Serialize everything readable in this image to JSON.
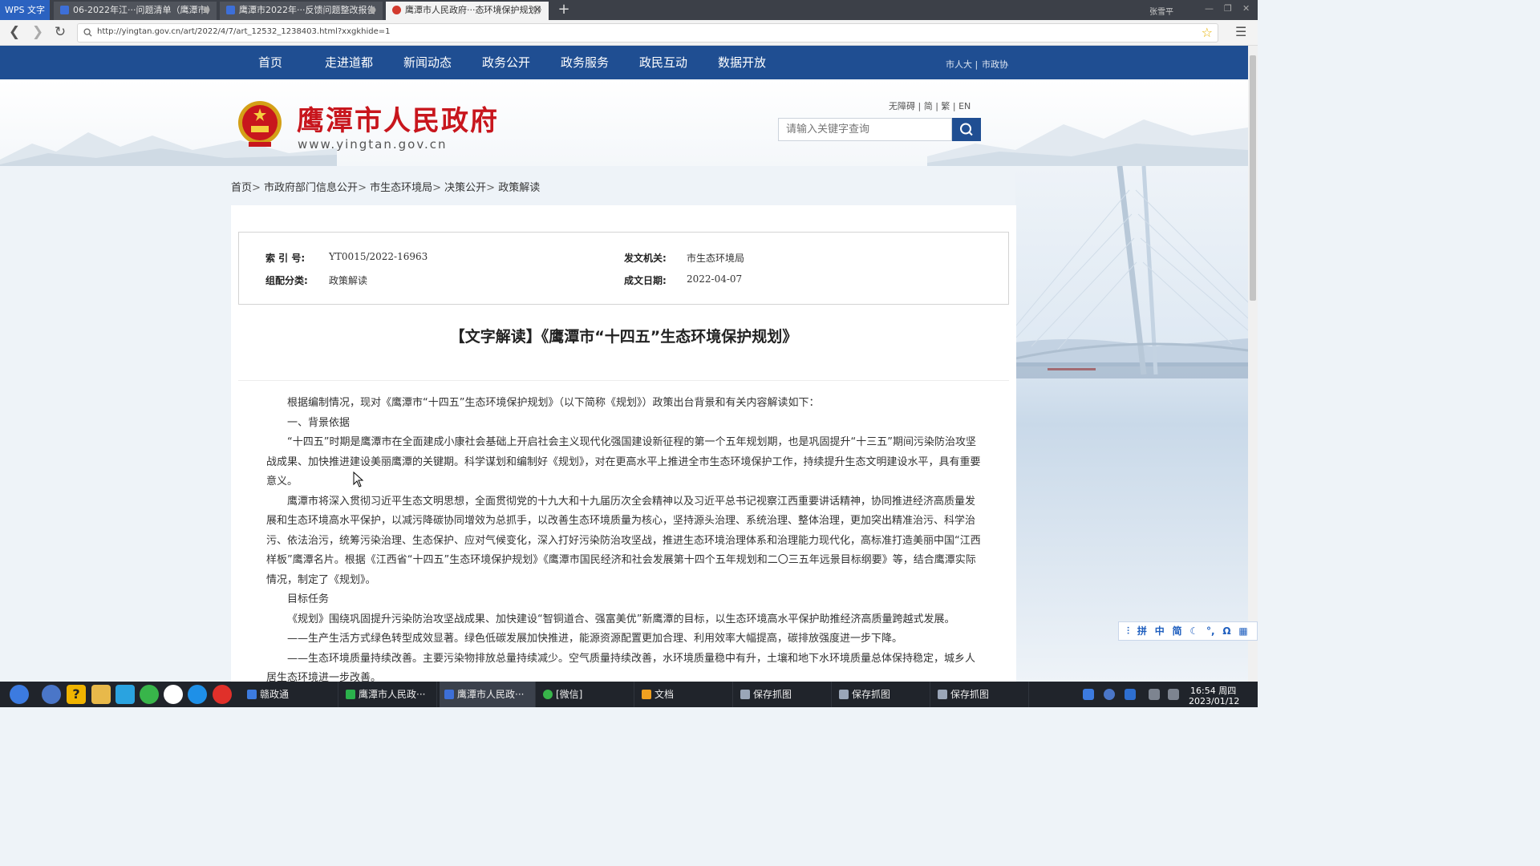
{
  "browser": {
    "app_name": "WPS 文字",
    "tabs": [
      {
        "label": "06-2022年江···问题清单（鹰潭市）"
      },
      {
        "label": "鹰潭市2022年···反馈问题整改报告"
      },
      {
        "label": "鹰潭市人民政府···态环境保护规划》"
      }
    ],
    "new_tab": "+",
    "user": "张雪平",
    "url": "http://yingtan.gov.cn/art/2022/4/7/art_12532_1238403.html?xxgkhide=1"
  },
  "site": {
    "nav": [
      "首页",
      "走进道都",
      "新闻动态",
      "政务公开",
      "政务服务",
      "政民互动",
      "数据开放"
    ],
    "nav_side": [
      "市人大",
      "市政协"
    ],
    "title": "鹰潭市人民政府",
    "url_text": "www.yingtan.gov.cn",
    "lang_links": [
      "无障碍",
      "简",
      "繁",
      "EN"
    ],
    "search_placeholder": "请输入关键字查询"
  },
  "breadcrumb": [
    "首页",
    "市政府部门信息公开",
    "市生态环境局",
    "决策公开",
    "政策解读"
  ],
  "meta": {
    "index_label": "索 引 号:",
    "index_value": "YT0015/2022-16963",
    "issuer_label": "发文机关:",
    "issuer_value": "市生态环境局",
    "category_label": "组配分类:",
    "category_value": "政策解读",
    "date_label": "成文日期:",
    "date_value": "2022-04-07"
  },
  "article": {
    "title": "【文字解读】《鹰潭市“十四五”生态环境保护规划》",
    "paragraphs": [
      "根据编制情况，现对《鹰潭市“十四五”生态环境保护规划》（以下简称《规划》）政策出台背景和有关内容解读如下：",
      "一、背景依据",
      "“十四五”时期是鹰潭市在全面建成小康社会基础上开启社会主义现代化强国建设新征程的第一个五年规划期，也是巩固提升“十三五”期间污染防治攻坚战成果、加快推进建设美丽鹰潭的关键期。科学谋划和编制好《规划》，对在更高水平上推进全市生态环境保护工作，持续提升生态文明建设水平，具有重要意义。",
      "鹰潭市将深入贯彻习近平生态文明思想，全面贯彻党的十九大和十九届历次全会精神以及习近平总书记视察江西重要讲话精神，协同推进经济高质量发展和生态环境高水平保护，以减污降碳协同增效为总抓手，以改善生态环境质量为核心，坚持源头治理、系统治理、整体治理，更加突出精准治污、科学治污、依法治污，统筹污染治理、生态保护、应对气候变化，深入打好污染防治攻坚战，推进生态环境治理体系和治理能力现代化，高标准打造美丽中国“江西样板”鹰潭名片。根据《江西省“十四五”生态环境保护规划》《鹰潭市国民经济和社会发展第十四个五年规划和二〇三五年远景目标纲要》等，结合鹰潭实际情况，制定了《规划》。",
      "目标任务",
      "《规划》围绕巩固提升污染防治攻坚战成果、加快建设“智铜道合、强富美优”新鹰潭的目标，以生态环境高水平保护助推经济高质量跨越式发展。",
      "——生产生活方式绿色转型成效显著。绿色低碳发展加快推进，能源资源配置更加合理、利用效率大幅提高，碳排放强度进一步下降。",
      "——生态环境质量持续改善。主要污染物排放总量持续减少。空气质量持续改善，水环境质量稳中有升，土壤和地下水环境质量总体保持稳定，城乡人居生态环境进一步改善。"
    ]
  },
  "ime": [
    "拼",
    "中",
    "简",
    "°,",
    "Ω"
  ],
  "taskbar": {
    "tasks": [
      "赣政通",
      "鹰潭市人民政···",
      "鹰潭市人民政···",
      "[微信]",
      "文档",
      "保存抓图",
      "保存抓图",
      "保存抓图"
    ],
    "time": "16:54 周四",
    "date": "2023/01/12"
  }
}
